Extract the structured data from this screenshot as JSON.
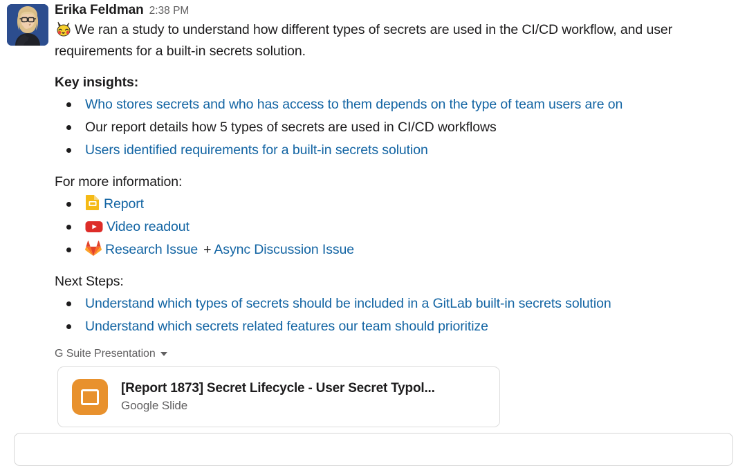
{
  "message": {
    "author": "Erika Feldman",
    "timestamp": "2:38 PM",
    "avatar_icon": "user-avatar-photo",
    "emoji_icon": "pikachu-emoji",
    "intro_text": "We ran a study to understand how different types of secrets are used in the CI/CD workflow, and user requirements for a built-in secrets solution.",
    "sections": [
      {
        "heading": "Key insights:",
        "heading_bold": true,
        "items": [
          {
            "text": "Who stores secrets and who has access to them depends on the type of team users are on",
            "is_link": true
          },
          {
            "text": "Our report details how 5 types of secrets are used in CI/CD workflows",
            "is_link": false
          },
          {
            "text": "Users identified requirements for a built-in secrets solution",
            "is_link": true
          }
        ]
      },
      {
        "heading": "For more information:",
        "heading_bold": false,
        "items": [
          {
            "text": "Report",
            "is_link": true,
            "icon": "google-slides-icon"
          },
          {
            "text": "Video readout",
            "is_link": true,
            "icon": "youtube-icon"
          },
          {
            "text": "Research Issue",
            "is_link": true,
            "icon": "gitlab-icon",
            "separator": "+",
            "text2": "Async Discussion Issue"
          }
        ]
      },
      {
        "heading": "Next Steps:",
        "heading_bold": false,
        "items": [
          {
            "text": "Understand which types of secrets should be included in a GitLab built-in secrets solution",
            "is_link": true
          },
          {
            "text": "Understand which secrets related features our team should prioritize",
            "is_link": true
          }
        ]
      }
    ]
  },
  "attachment": {
    "label": "G Suite Presentation",
    "chevron_icon": "chevron-down-icon",
    "file_icon": "google-slides-file-icon",
    "title": "[Report 1873] Secret Lifecycle - User Secret Typol...",
    "subtitle": "Google Slide"
  },
  "colors": {
    "link": "#1264a3",
    "text": "#1d1c1d",
    "muted": "#616061",
    "slides_orange": "#e8912d",
    "youtube_red": "#dd2c28",
    "slides_yellow": "#f5ba15",
    "gitlab_orange": "#e24329",
    "card_border": "#dddddd"
  }
}
